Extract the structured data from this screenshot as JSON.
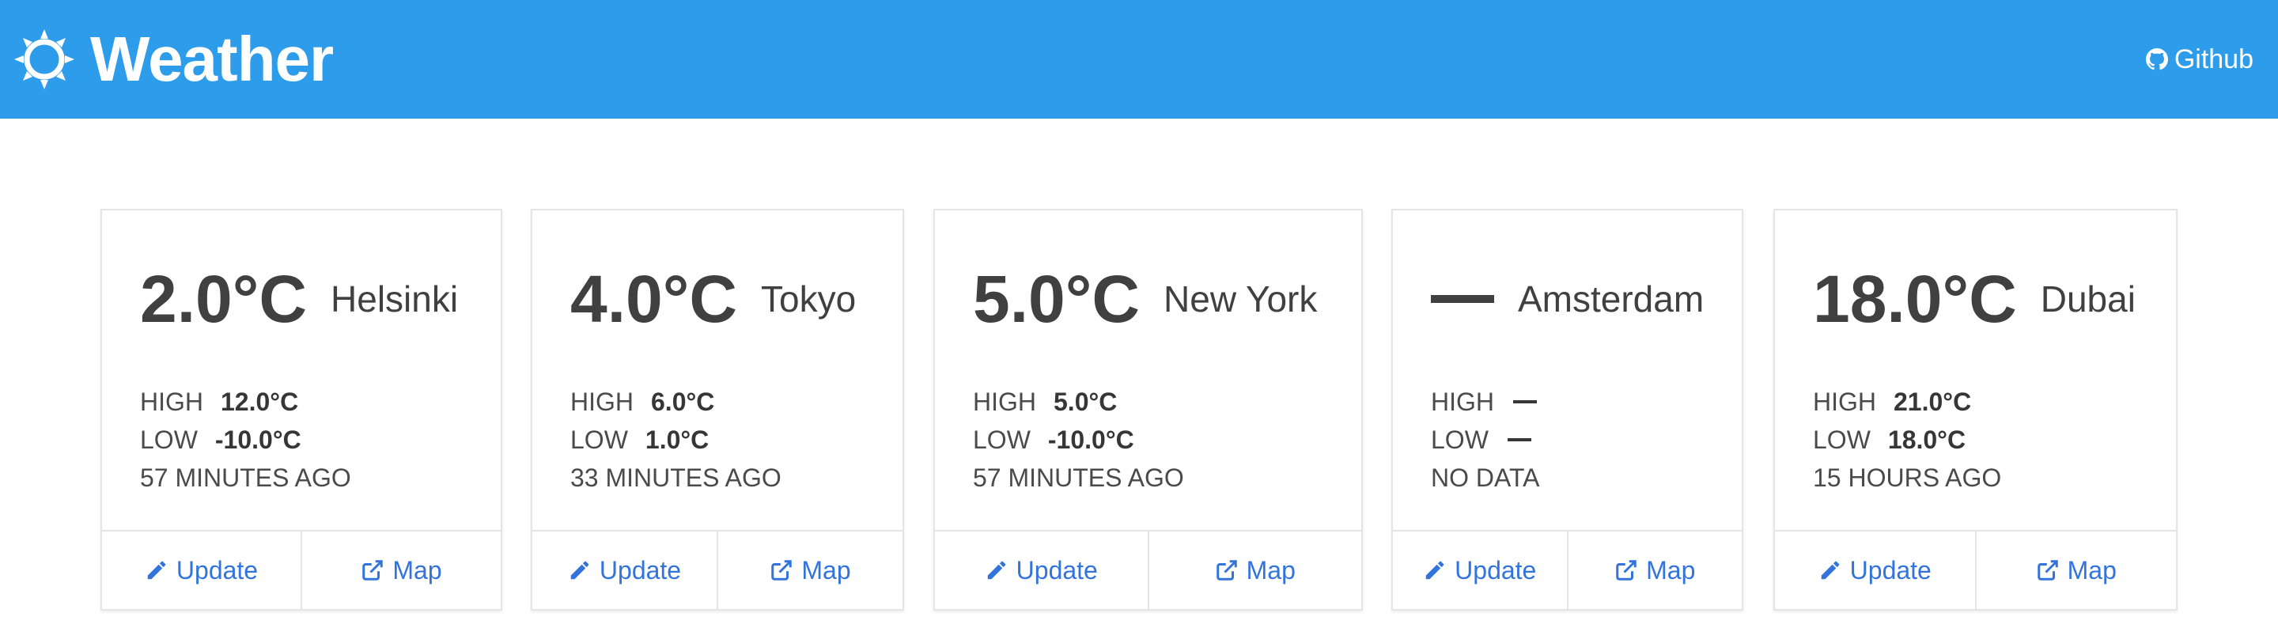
{
  "header": {
    "brand_icon": "sun-icon",
    "title": "Weather",
    "github_icon": "github-icon",
    "github_label": "Github",
    "background_color": "#2d9cea"
  },
  "cards": [
    {
      "temperature": "2.0°C",
      "city": "Helsinki",
      "high_label": "HIGH",
      "high": "12.0°C",
      "low_label": "LOW",
      "low": "-10.0°C",
      "updated": "57 MINUTES AGO",
      "update_label": "Update",
      "map_label": "Map"
    },
    {
      "temperature": "4.0°C",
      "city": "Tokyo",
      "high_label": "HIGH",
      "high": "6.0°C",
      "low_label": "LOW",
      "low": "1.0°C",
      "updated": "33 MINUTES AGO",
      "update_label": "Update",
      "map_label": "Map"
    },
    {
      "temperature": "5.0°C",
      "city": "New York",
      "high_label": "HIGH",
      "high": "5.0°C",
      "low_label": "LOW",
      "low": "-10.0°C",
      "updated": "57 MINUTES AGO",
      "update_label": "Update",
      "map_label": "Map"
    },
    {
      "temperature": null,
      "city": "Amsterdam",
      "high_label": "HIGH",
      "high": null,
      "low_label": "LOW",
      "low": null,
      "updated": "NO DATA",
      "update_label": "Update",
      "map_label": "Map"
    },
    {
      "temperature": "18.0°C",
      "city": "Dubai",
      "high_label": "HIGH",
      "high": "21.0°C",
      "low_label": "LOW",
      "low": "18.0°C",
      "updated": "15 HOURS AGO",
      "update_label": "Update",
      "map_label": "Map"
    }
  ],
  "icons": {
    "update": "pencil-icon",
    "map": "external-link-icon"
  },
  "colors": {
    "link": "#3273dc",
    "border": "#e5e5e5"
  }
}
